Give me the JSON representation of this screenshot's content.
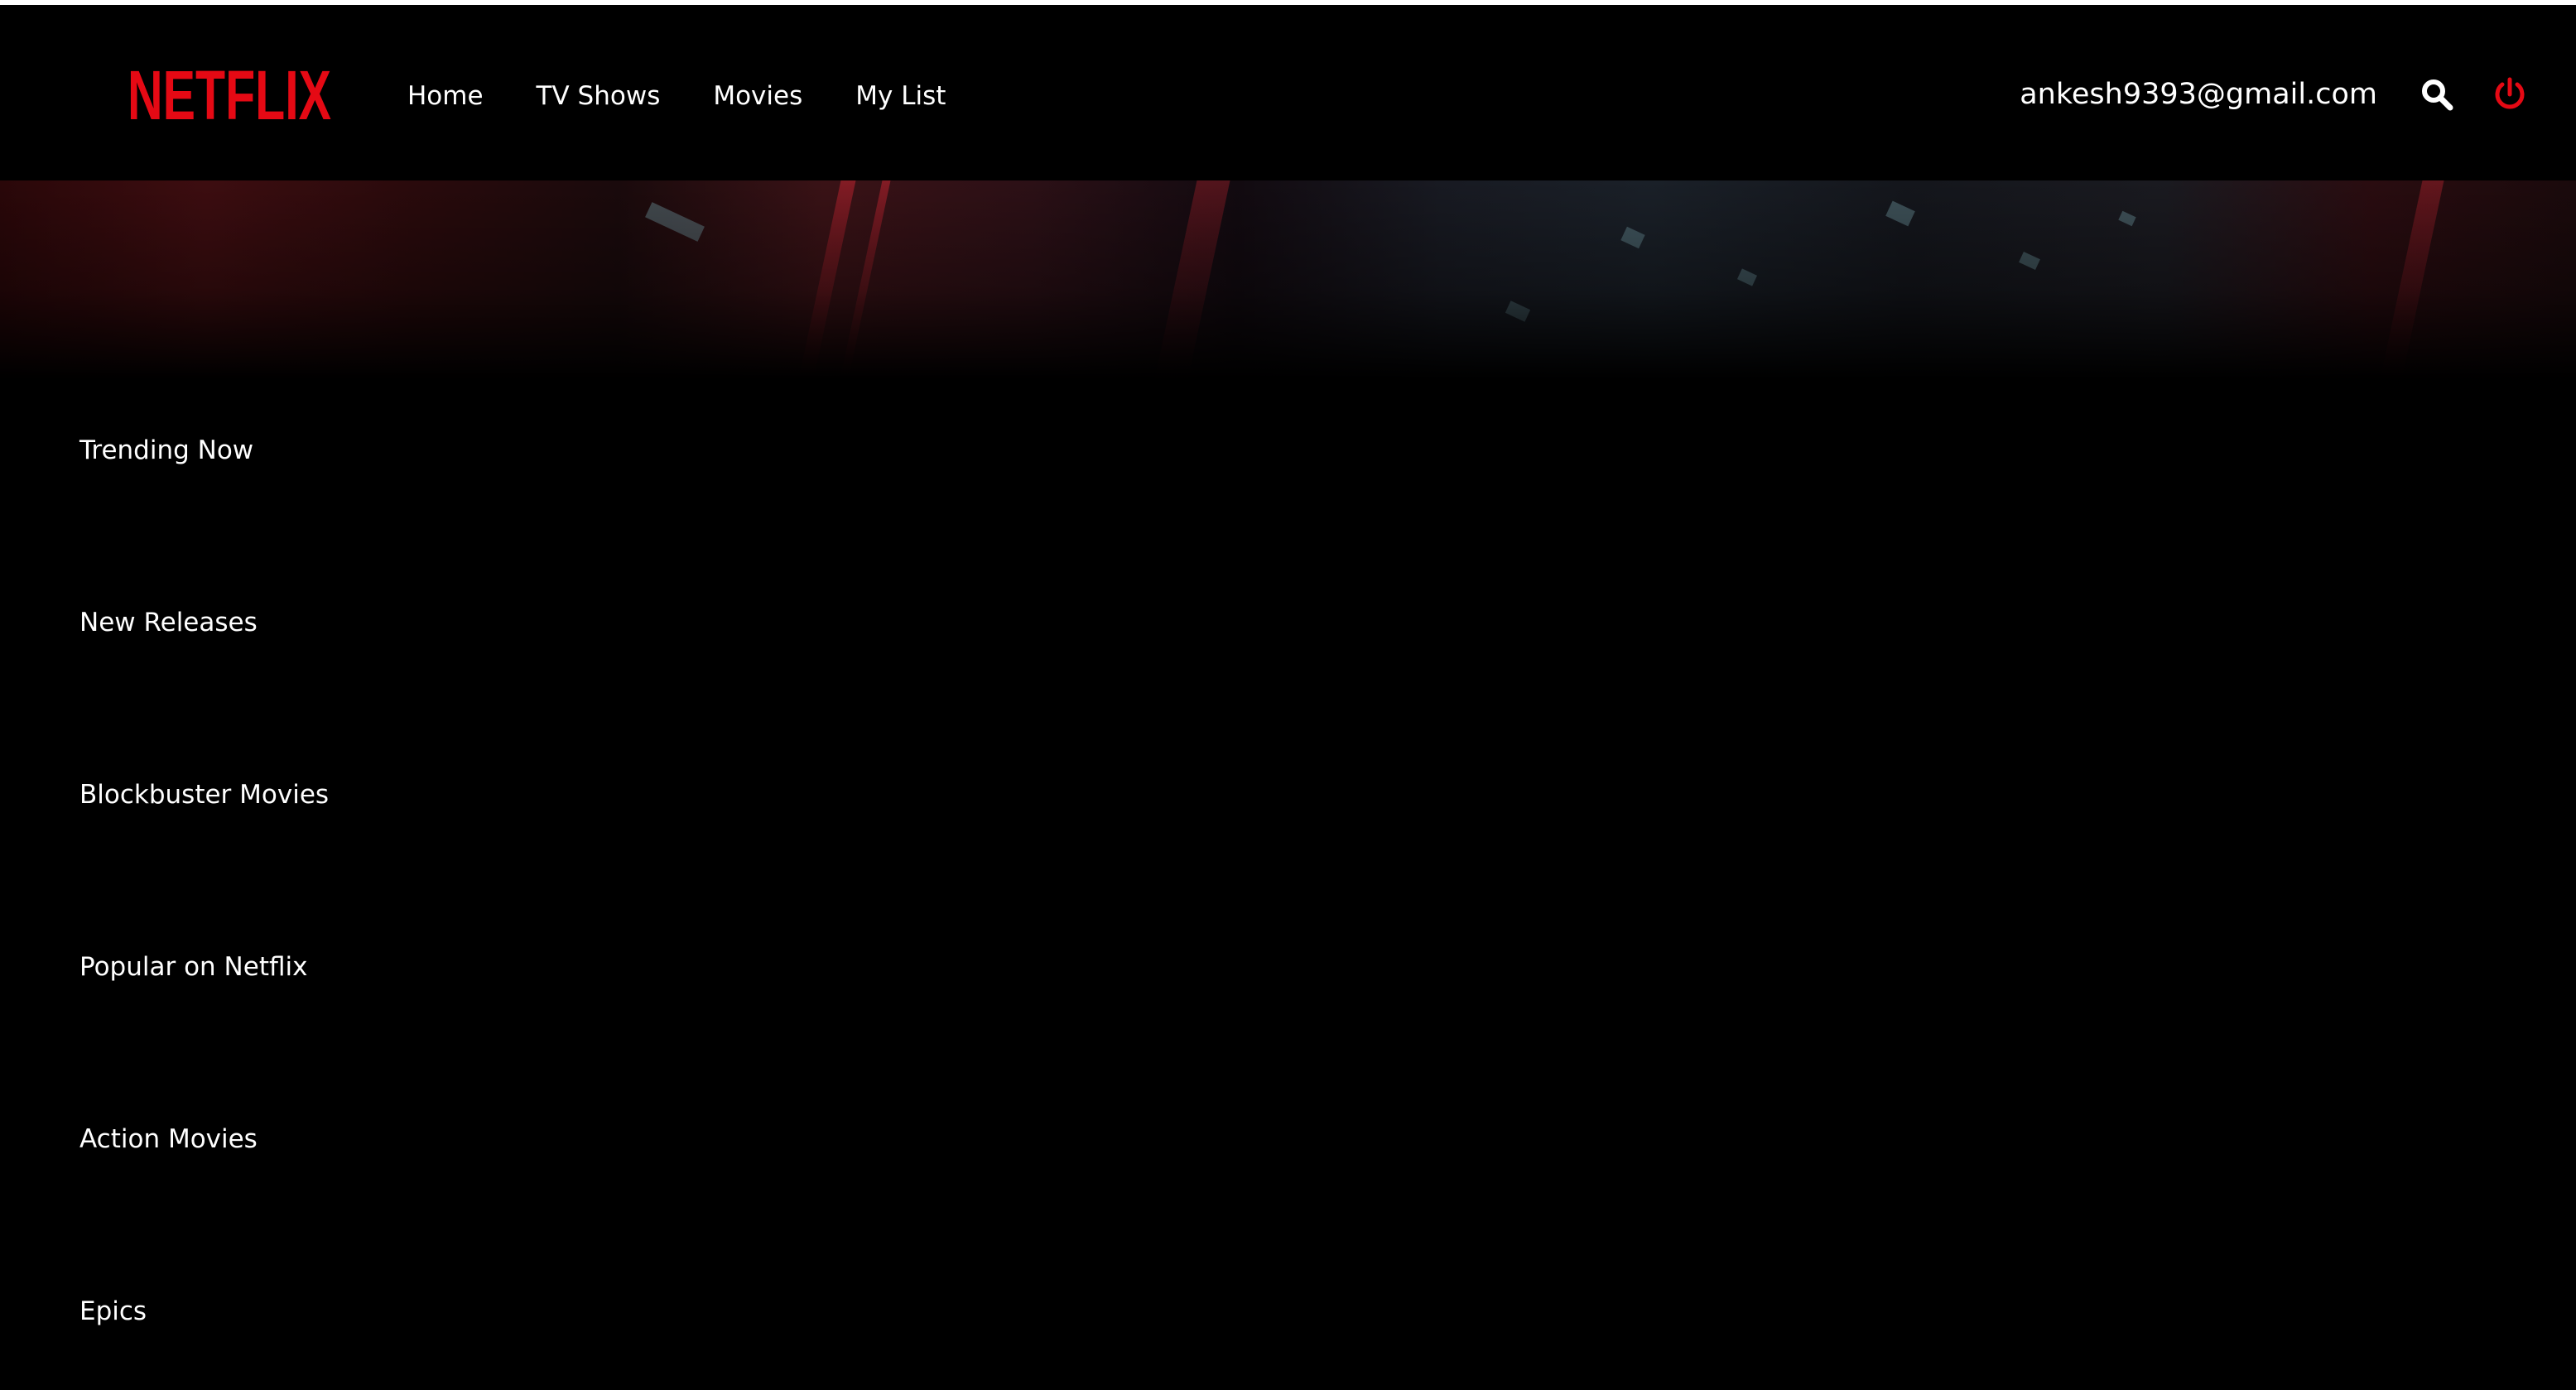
{
  "brand": {
    "logo_text": "NETFLIX",
    "color": "#e50914"
  },
  "nav": {
    "links": [
      "Home",
      "TV Shows",
      "Movies",
      "My List"
    ]
  },
  "user": {
    "email": "ankesh9393@gmail.com"
  },
  "icons": {
    "search": "search-icon",
    "power": "power-icon"
  },
  "colors": {
    "background": "#000000",
    "text": "#ffffff",
    "accent": "#e50914"
  },
  "rows": [
    {
      "title": "Trending Now"
    },
    {
      "title": "New Releases"
    },
    {
      "title": "Blockbuster Movies"
    },
    {
      "title": "Popular on Netflix"
    },
    {
      "title": "Action Movies"
    },
    {
      "title": "Epics"
    }
  ]
}
